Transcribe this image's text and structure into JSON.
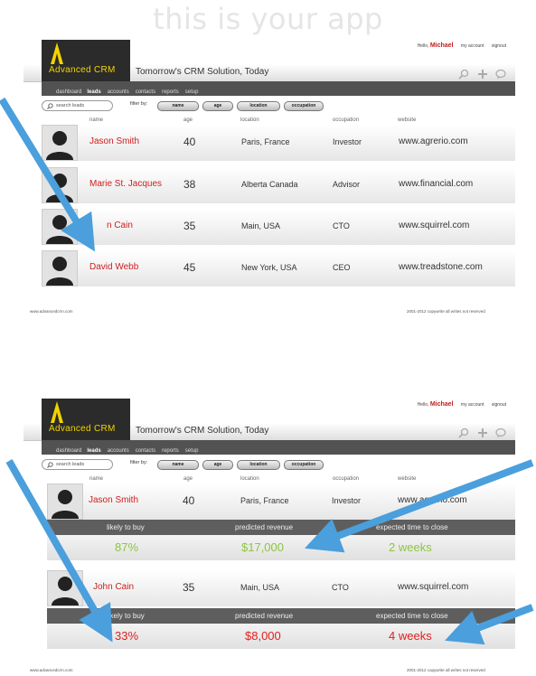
{
  "headline": "this is your app",
  "app": {
    "logo_name": "Advanced CRM",
    "tagline": "Tomorrow's CRM Solution, Today",
    "user": {
      "hello": "Hello,",
      "name": "Michael",
      "account": "my account",
      "signout": "signout"
    },
    "nav": [
      "dashboard",
      "leads",
      "accounts",
      "contacts",
      "reports",
      "setup"
    ],
    "active_nav": "leads",
    "search_placeholder": "search leads",
    "filter_label": "filter by:",
    "filters": [
      "name",
      "age",
      "location",
      "occupation"
    ],
    "columns": [
      "name",
      "age",
      "location",
      "occupation",
      "website"
    ],
    "tool_icons": [
      "search-icon",
      "add-icon",
      "chat-icon"
    ],
    "footer_left": "www.advancedcrm.com",
    "footer_right": "2001-2012 copywrite all writes not reserved"
  },
  "screen1": {
    "leads": [
      {
        "name": "Jason Smith",
        "age": "40",
        "location": "Paris, France",
        "occupation": "Investor",
        "website": "www.agrerio.com"
      },
      {
        "name": "Marie St. Jacques",
        "age": "38",
        "location": "Alberta Canada",
        "occupation": "Advisor",
        "website": "www.financial.com"
      },
      {
        "name": "n Cain",
        "age": "35",
        "location": "Main, USA",
        "occupation": "CTO",
        "website": "www.squirrel.com"
      },
      {
        "name": "David Webb",
        "age": "45",
        "location": "New York, USA",
        "occupation": "CEO",
        "website": "www.treadstone.com"
      }
    ]
  },
  "screen2": {
    "leads": [
      {
        "name": "Jason Smith",
        "age": "40",
        "location": "Paris, France",
        "occupation": "Investor",
        "website": "www.agrerio.com",
        "details": {
          "likely_label": "likely to buy",
          "likely": "87%",
          "revenue_label": "predicted revenue",
          "revenue": "$17,000",
          "time_label": "expected time to close",
          "time": "2 weeks"
        }
      },
      {
        "name": "John Cain",
        "age": "35",
        "location": "Main, USA",
        "occupation": "CTO",
        "website": "www.squirrel.com",
        "details": {
          "likely_label": "likely to buy",
          "likely": "33%",
          "revenue_label": "predicted revenue",
          "revenue": "$8,000",
          "time_label": "expected time to close",
          "time": "4 weeks"
        }
      }
    ]
  },
  "colors": {
    "accent_red": "#d01d1d",
    "good_green": "#8cc63f",
    "arrow_blue": "#4a9fdc",
    "logo_yellow": "#f2d300"
  }
}
